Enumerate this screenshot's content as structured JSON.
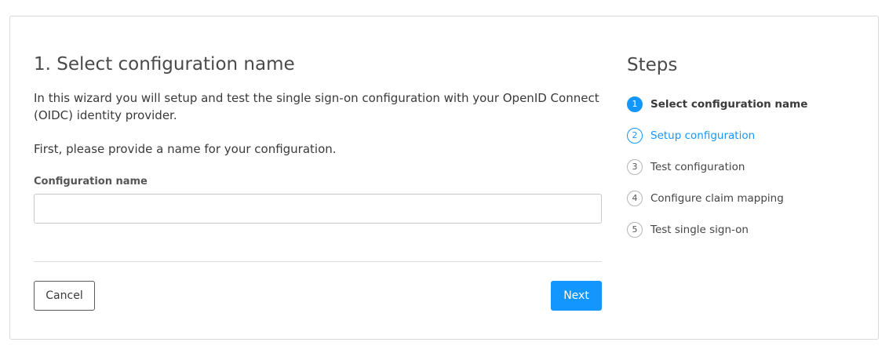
{
  "wizard": {
    "title": "1. Select configuration name",
    "intro": "In this wizard you will setup and test the single sign-on configuration with your OpenID Connect (OIDC) identity provider.",
    "prompt": "First, please provide a name for your configuration.",
    "field": {
      "label": "Configuration name",
      "value": "",
      "placeholder": ""
    },
    "buttons": {
      "cancel": "Cancel",
      "next": "Next"
    }
  },
  "steps": {
    "title": "Steps",
    "items": [
      {
        "number": "1",
        "label": "Select configuration name",
        "state": "active"
      },
      {
        "number": "2",
        "label": "Setup configuration",
        "state": "link"
      },
      {
        "number": "3",
        "label": "Test configuration",
        "state": "default"
      },
      {
        "number": "4",
        "label": "Configure claim mapping",
        "state": "default"
      },
      {
        "number": "5",
        "label": "Test single sign-on",
        "state": "default"
      }
    ]
  },
  "colors": {
    "accent": "#1496ff",
    "text": "#3a3a3a",
    "border": "#d9d9d9"
  }
}
